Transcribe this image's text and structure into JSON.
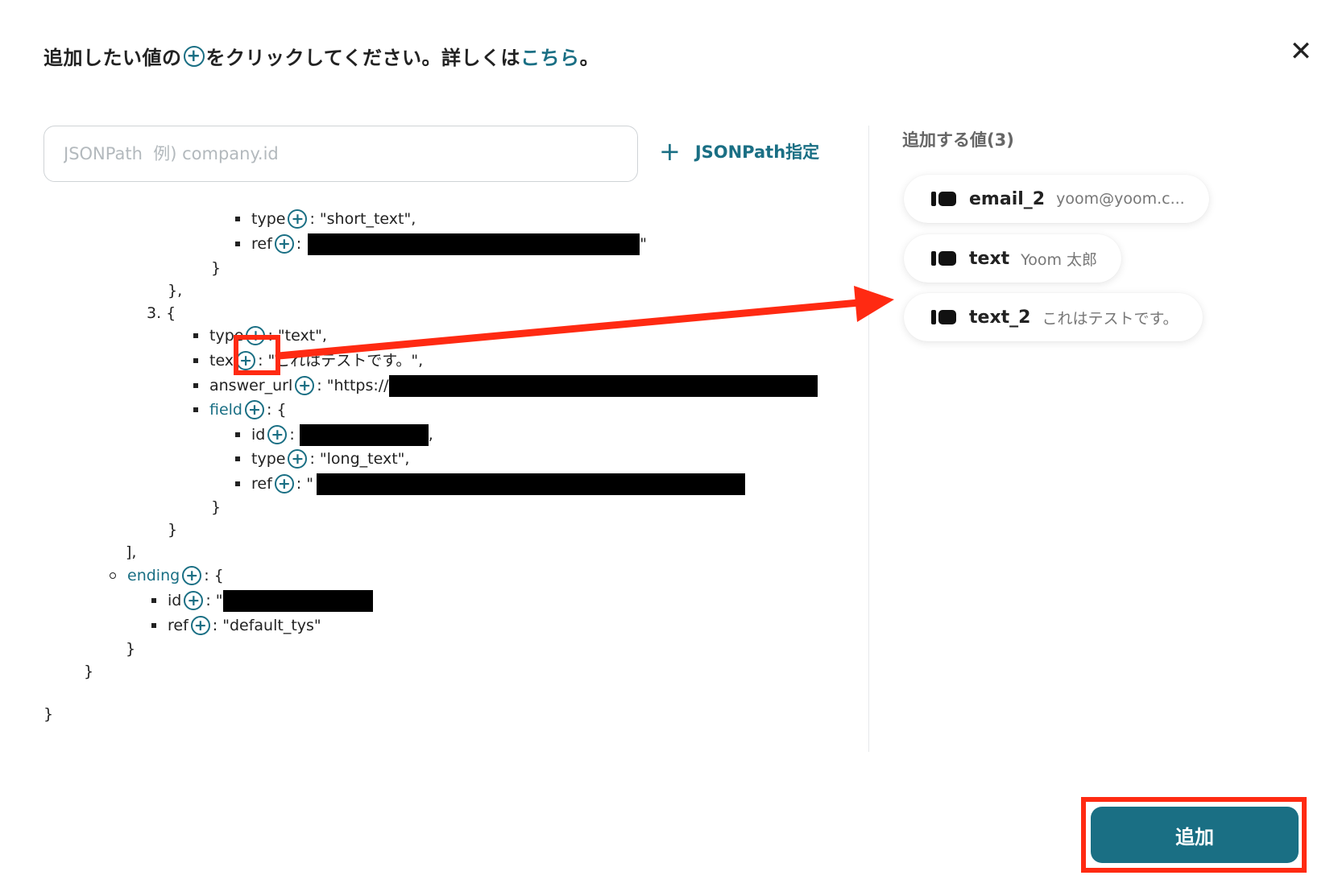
{
  "header": {
    "prefix": "追加したい値の",
    "suffix": "をクリックしてください。詳しくは",
    "link": "こちら",
    "end": "。"
  },
  "jsonpath": {
    "placeholder": "JSONPath  例) company.id",
    "button_label": "JSONPath指定"
  },
  "tree": {
    "l1_key": "type",
    "l1_val": ": \"short_text\",",
    "l2_key": "ref",
    "l2_val": ":",
    "l2_end": "\"",
    "l3": "}",
    "l4": "},",
    "l5": "3. {",
    "l6_key": "type",
    "l6_val": ": \"text\",",
    "l7_key": "tex",
    "l7_val": ": \"これはテストです。\",",
    "l8_key": "answer_url",
    "l8_val": ": \"https://",
    "l9_key": "field",
    "l9_val": ": {",
    "l10_key": "id",
    "l10_val": ":",
    "l10_end": ",",
    "l11_key": "type",
    "l11_val": ": \"long_text\",",
    "l12_key": "ref",
    "l12_val": ": \"",
    "l13": "}",
    "l14": "}",
    "l15": "],",
    "l16_key": "ending",
    "l16_val": ": {",
    "l17_key": "id",
    "l17_val": ": \"",
    "l18_key": "ref",
    "l18_val": ": \"default_tys\"",
    "l19": "}",
    "l20": "}",
    "l21": "}"
  },
  "selected": {
    "heading": "追加する値(3)",
    "items": [
      {
        "name": "email_2",
        "value": "yoom@yoom.c..."
      },
      {
        "name": "text",
        "value": "Yoom 太郎"
      },
      {
        "name": "text_2",
        "value": "これはテストです。"
      }
    ]
  },
  "footer": {
    "add_label": "追加"
  },
  "icons": {
    "close": "close-icon",
    "add_value": "plus-circle-icon",
    "field_chip": "field-chip-icon"
  },
  "colors": {
    "accent": "#1a6f84",
    "annotation": "#ff2a12"
  }
}
